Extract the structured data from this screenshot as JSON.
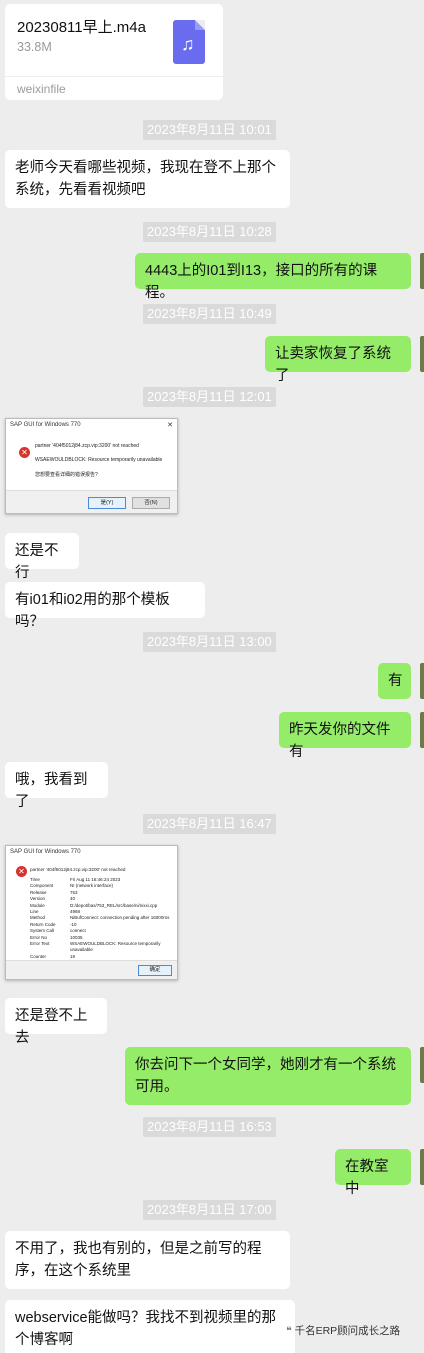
{
  "file_message": {
    "name": "20230811早上.m4a",
    "size": "33.8M",
    "source": "weixinfile",
    "icon": "music-note-icon"
  },
  "timestamps": {
    "t1": "2023年8月11日 10:01",
    "t2": "2023年8月11日 10:28",
    "t3": "2023年8月11日 10:49",
    "t4": "2023年8月11日 12:01",
    "t5": "2023年8月11日 13:00",
    "t6": "2023年8月11日 16:47",
    "t7": "2023年8月11日 16:53",
    "t8": "2023年8月11日 17:00"
  },
  "messages": {
    "m1": "老师今天看哪些视频，我现在登不上那个系统，先看看视频吧",
    "m2": "4443上的I01到I13，接口的所有的课程。",
    "m3": "让卖家恢复了系统了",
    "m4": "还是不行",
    "m5": "有i01和i02用的那个模板吗？",
    "m6": "有",
    "m7": "昨天发你的文件有",
    "m8": "哦，我看到了",
    "m9": "还是登不上去",
    "m10": "你去问下一个女同学，她刚才有一个系统可用。",
    "m11": "在教室中",
    "m12": "不用了，我也有别的，但是之前写的程序，在这个系统里",
    "m13": "webservice能做吗？我找不到视频里的那个博客啊"
  },
  "dialog1": {
    "title": "SAP GUI for Windows 770",
    "line1": "partner '404f5012j84.zcp.vip:3200' not reached",
    "line2": "WSAEWOULDBLOCK: Resource temporarily unavailable",
    "line3": "您想要查看详细的错误报告?",
    "yes": "是(Y)",
    "no": "否(N)"
  },
  "dialog2": {
    "title": "SAP GUI for Windows 770",
    "header": "partner '404f5012j84.zcp.vip:3200' not reached",
    "rows": [
      [
        "Time",
        "Fri Aug 11 16:46:24 2023"
      ],
      [
        "Component",
        "NI (network interface)"
      ],
      [
        "Release",
        "753"
      ],
      [
        "Version",
        "40"
      ],
      [
        "Module",
        "D:/depot/bas/753_REL/src/base/ni/nixxi.cpp"
      ],
      [
        "Line",
        "4968"
      ],
      [
        "Method",
        "NiBufConnect: connection pending after 16000ms"
      ],
      [
        "Return Code",
        "-10"
      ],
      [
        "System Call",
        "connect"
      ],
      [
        "Error No",
        "10035"
      ],
      [
        "Error Text",
        "WSAEWOULDBLOCK: Resource temporarily"
      ],
      [
        "",
        "unavailable"
      ],
      [
        "Counter",
        "19"
      ]
    ],
    "ok": "确定"
  },
  "watermark": "千名ERP顾问成长之路"
}
